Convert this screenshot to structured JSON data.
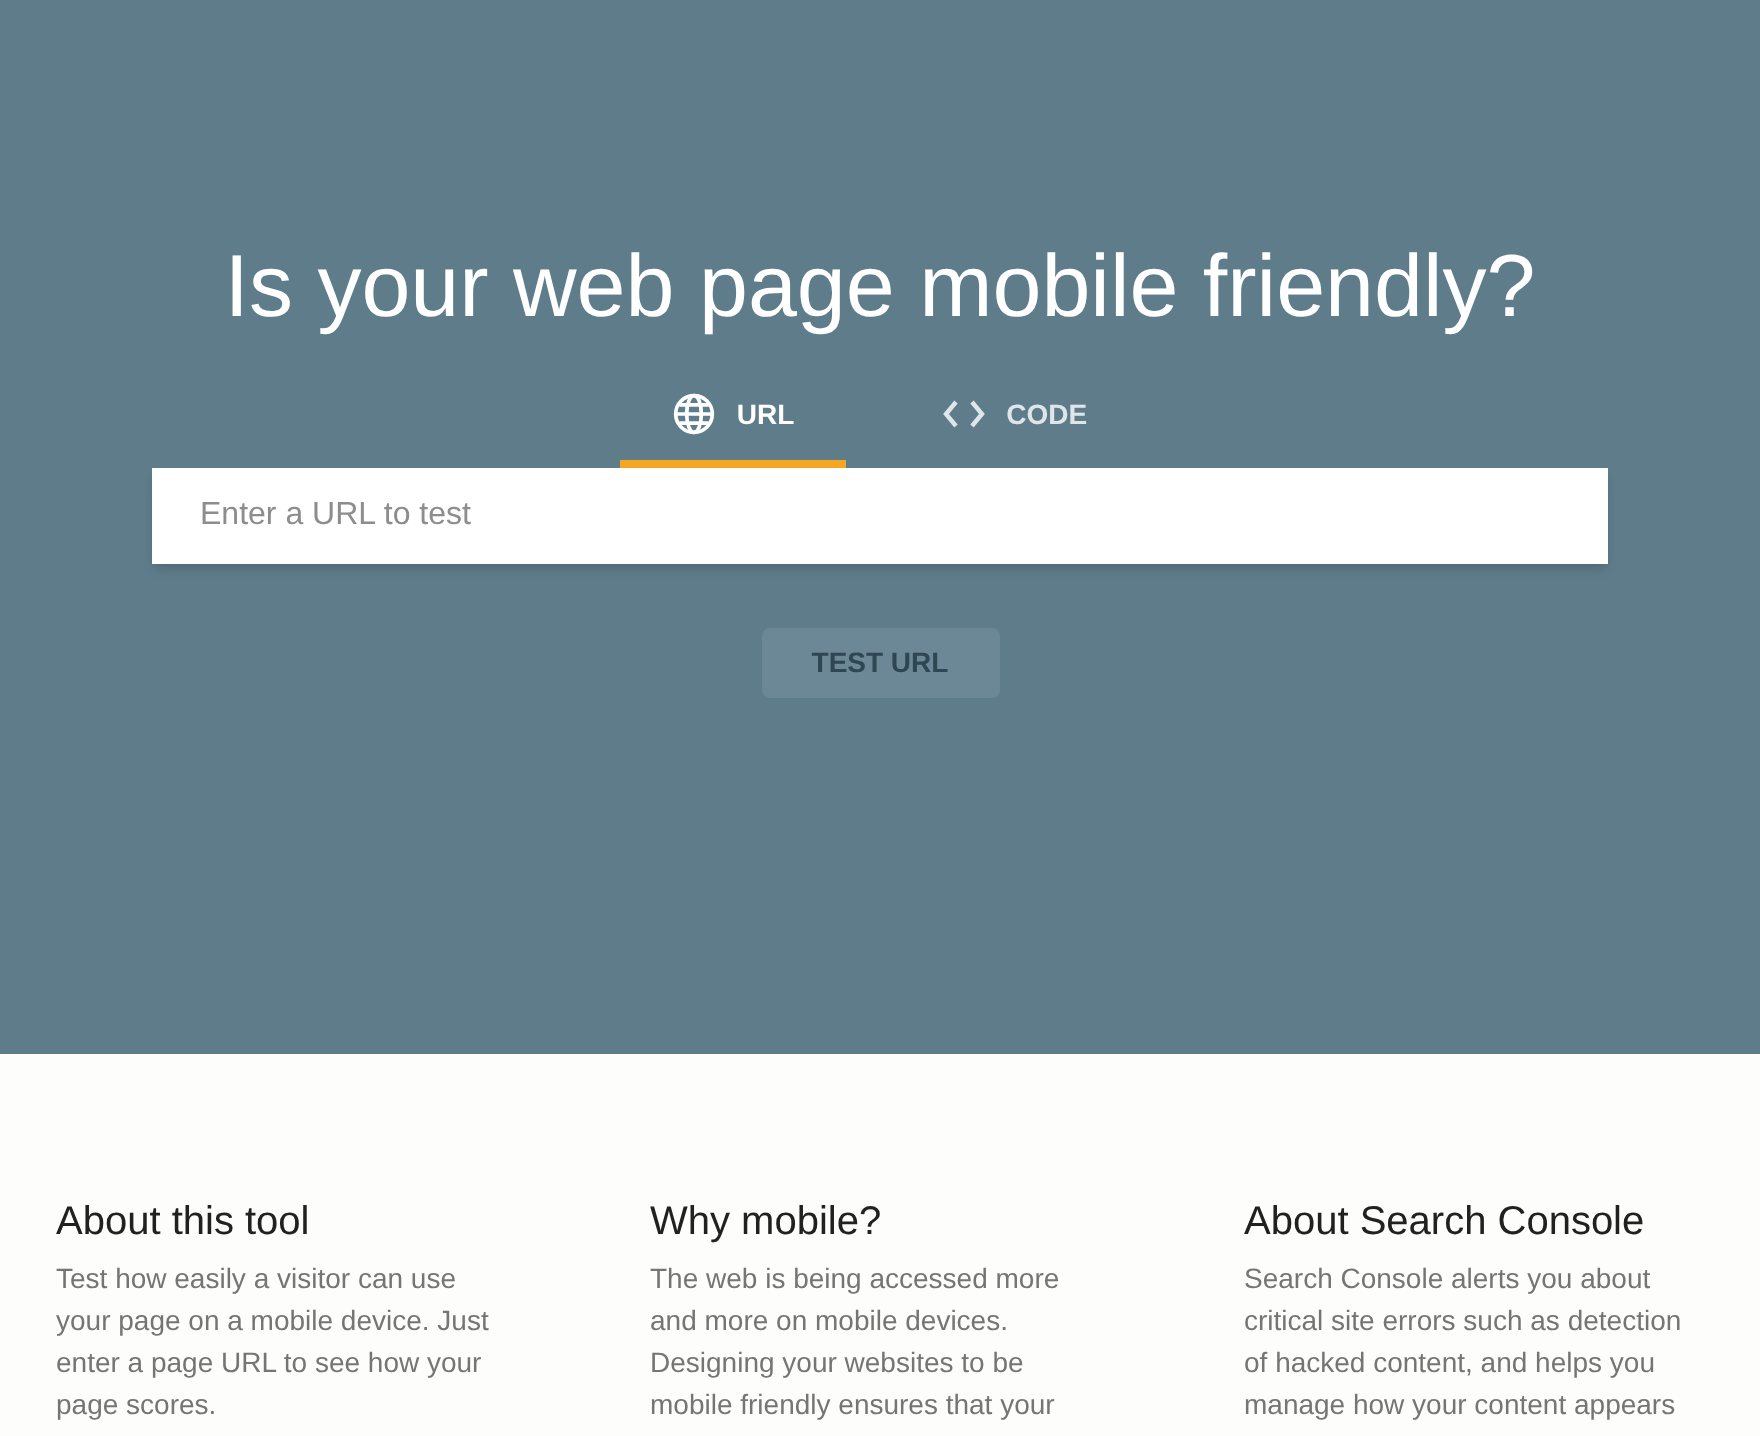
{
  "hero": {
    "title": "Is your web page mobile friendly?",
    "tabs": [
      {
        "kind": "url",
        "label": "URL",
        "selected": true
      },
      {
        "kind": "code",
        "label": "CODE",
        "selected": false
      }
    ],
    "search": {
      "placeholder": "Enter a URL to test"
    },
    "button": {
      "label": "TEST URL",
      "disabled": true
    }
  },
  "info_columns": [
    {
      "heading": "About this tool",
      "text": "Test how easily a visitor can use your page on a mobile device. Just enter a page URL to see how your page scores."
    },
    {
      "heading": "Why mobile?",
      "text": "The web is being accessed more and more on mobile devices. Designing your websites to be mobile friendly ensures that your"
    },
    {
      "heading": "About Search Console",
      "text": "Search Console alerts you about critical site errors such as detection of hacked content, and helps you manage how your content appears"
    }
  ]
}
